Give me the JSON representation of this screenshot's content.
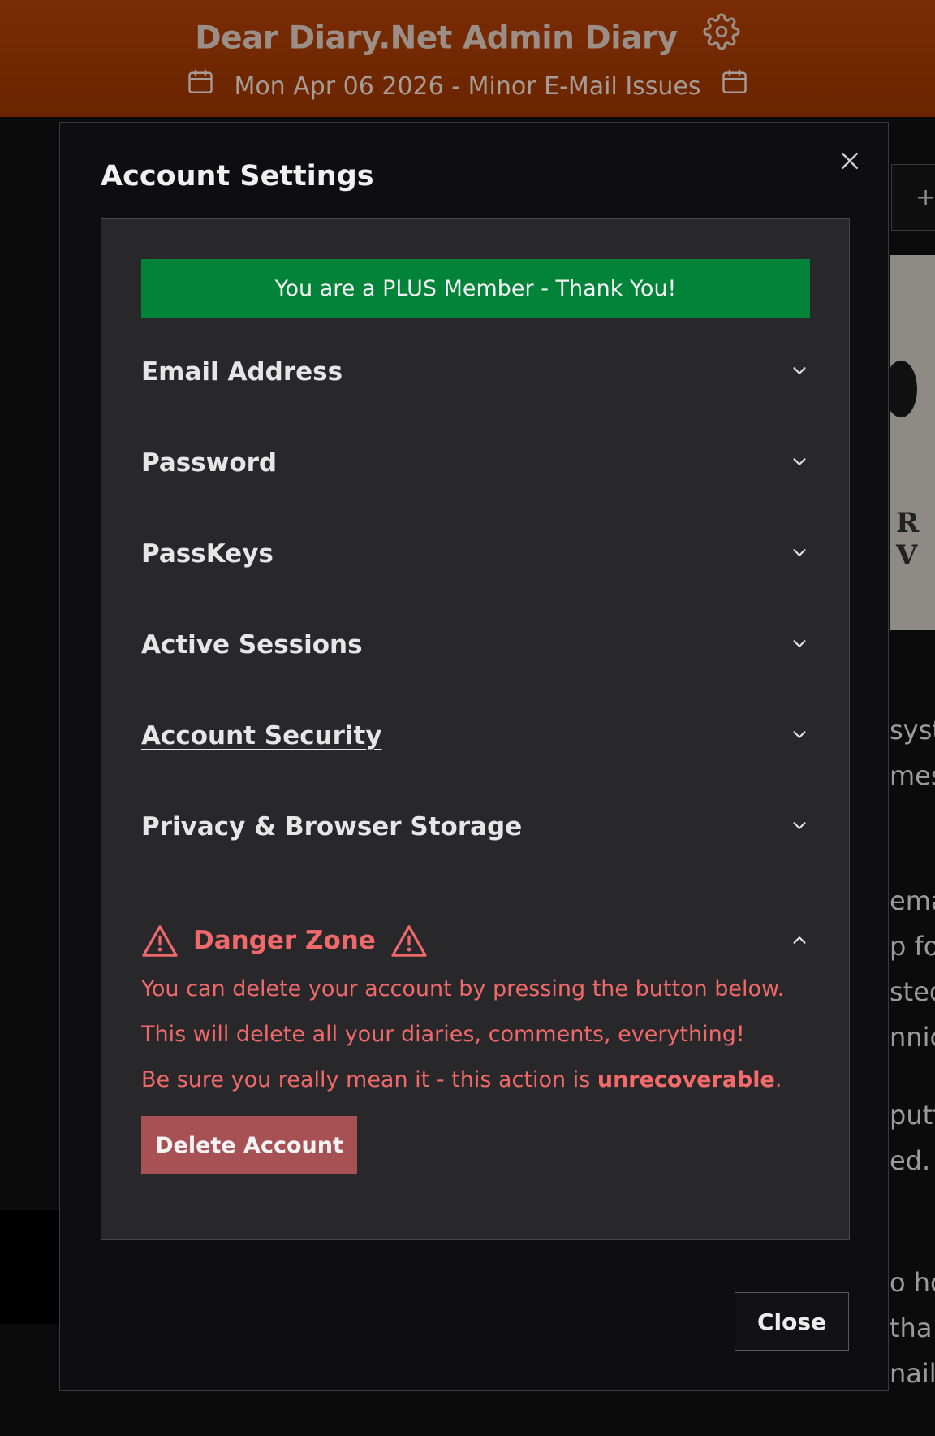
{
  "header": {
    "title": "Dear Diary.Net Admin Diary",
    "entry_title": "Mon Apr 06 2026 - Minor E-Mail Issues"
  },
  "background": {
    "text_fragments": [
      "syst",
      "mes",
      "emai",
      "p fo",
      "sted",
      "nnica",
      "putt",
      "ed. E",
      "o ho",
      "tha",
      "nail A"
    ]
  },
  "modal": {
    "title": "Account Settings",
    "plus_banner": "You are a PLUS Member - Thank You!",
    "sections": [
      {
        "label": "Email Address"
      },
      {
        "label": "Password"
      },
      {
        "label": "PassKeys"
      },
      {
        "label": "Active Sessions"
      },
      {
        "label": "Account Security"
      },
      {
        "label": "Privacy & Browser Storage"
      }
    ],
    "danger": {
      "label": "Danger Zone",
      "line1": "You can delete your account by pressing the button below.",
      "line2": "This will delete all your diaries, comments, everything!",
      "line3_prefix": "Be sure you really mean it - this action is ",
      "line3_bold": "unrecoverable",
      "line3_suffix": ".",
      "delete_button": "Delete Account"
    },
    "close_button": "Close"
  },
  "colors": {
    "header_bg": "#7a2c05",
    "plus_banner": "#018339",
    "danger_text": "#f0696a",
    "delete_button": "#a85154"
  },
  "icons": {
    "header": [
      "gear-icon",
      "calendar-icon"
    ],
    "sections": "chevron-down-icon",
    "danger": [
      "warning-icon",
      "chevron-up-icon"
    ],
    "modal": "close-icon"
  }
}
